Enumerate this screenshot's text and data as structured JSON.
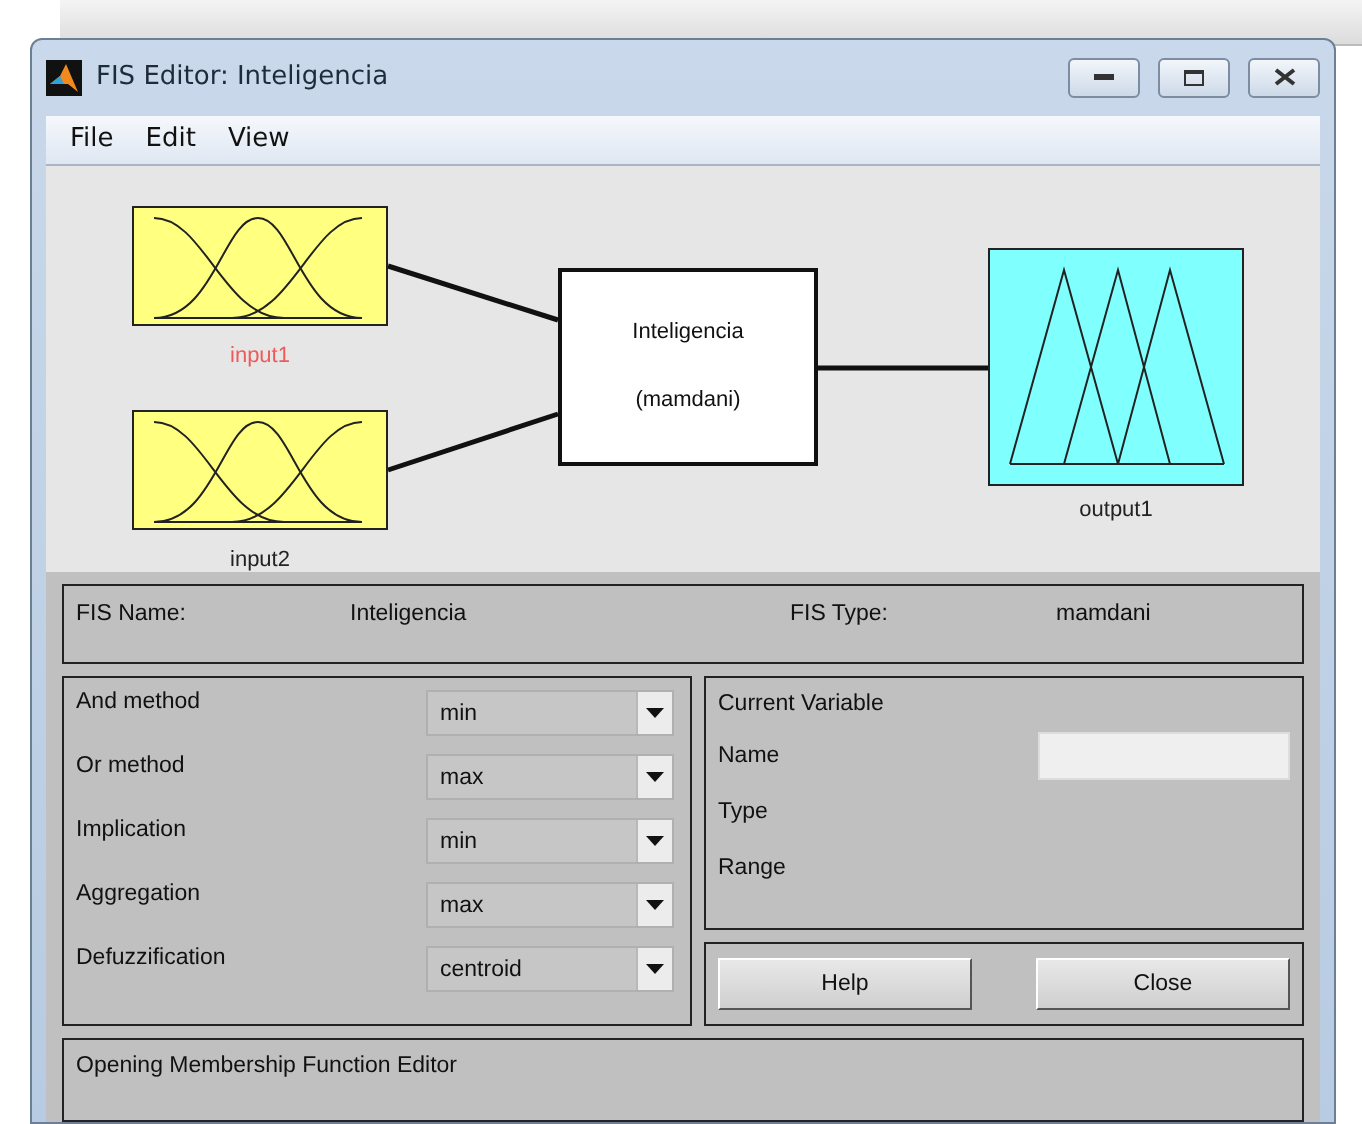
{
  "window": {
    "title": "FIS Editor: Inteligencia"
  },
  "menu": [
    "File",
    "Edit",
    "View"
  ],
  "diagram": {
    "inputs": [
      {
        "label": "input1",
        "selected": true
      },
      {
        "label": "input2",
        "selected": false
      }
    ],
    "system": {
      "name": "Inteligencia",
      "type": "(mamdani)"
    },
    "outputs": [
      {
        "label": "output1",
        "selected": false
      }
    ]
  },
  "fis_info": {
    "name_label": "FIS Name:",
    "name": "Inteligencia",
    "type_label": "FIS Type:",
    "type": "mamdani"
  },
  "methods": [
    {
      "label": "And method",
      "value": "min"
    },
    {
      "label": "Or method",
      "value": "max"
    },
    {
      "label": "Implication",
      "value": "min"
    },
    {
      "label": "Aggregation",
      "value": "max"
    },
    {
      "label": "Defuzzification",
      "value": "centroid"
    }
  ],
  "current_variable": {
    "title": "Current Variable",
    "fields": [
      {
        "label": "Name",
        "kind": "input"
      },
      {
        "label": "Type",
        "kind": "text"
      },
      {
        "label": "Range",
        "kind": "text"
      }
    ]
  },
  "buttons": [
    "Help",
    "Close"
  ],
  "status": "Opening Membership Function Editor"
}
